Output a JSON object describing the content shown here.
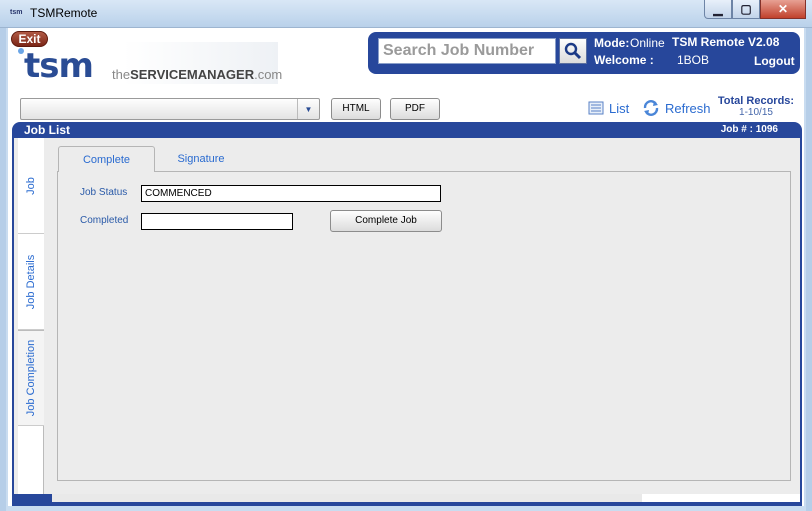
{
  "window": {
    "title": "TSMRemote",
    "icon_text": "tsm",
    "buttons": {
      "minimize": "▁",
      "maximize": "▢",
      "close": "✕"
    }
  },
  "header": {
    "exit_label": "Exit",
    "logo": {
      "tsm": "tsm",
      "sub_prefix": "the",
      "sub_brand": "SERVICEMANAGER",
      "sub_suffix": ".com"
    },
    "search": {
      "placeholder": "Search Job Number"
    },
    "mode_label": "Mode:",
    "mode_value": "Online",
    "app_version": "TSM Remote V2.08",
    "welcome_label": "Welcome :",
    "welcome_user": "1BOB",
    "logout_label": "Logout"
  },
  "toolbar": {
    "html_label": "HTML",
    "pdf_label": "PDF",
    "list_label": "List",
    "refresh_label": "Refresh",
    "total_records_label": "Total Records:",
    "total_records_value": "1-10/15"
  },
  "job_list": {
    "title": "Job List",
    "job_number": "Job # :  1096"
  },
  "side_tabs": [
    {
      "label": "Job"
    },
    {
      "label": "Job Details"
    },
    {
      "label": "Job Completion"
    }
  ],
  "tabs": [
    {
      "label": "Complete"
    },
    {
      "label": "Signature"
    }
  ],
  "form": {
    "job_status_label": "Job Status",
    "job_status_value": "COMMENCED",
    "completed_label": "Completed",
    "completed_value": "",
    "complete_button": "Complete Job"
  },
  "colors": {
    "brand_blue": "#27479b",
    "link_blue": "#2a6bd0",
    "exit_red": "#7b2617"
  }
}
